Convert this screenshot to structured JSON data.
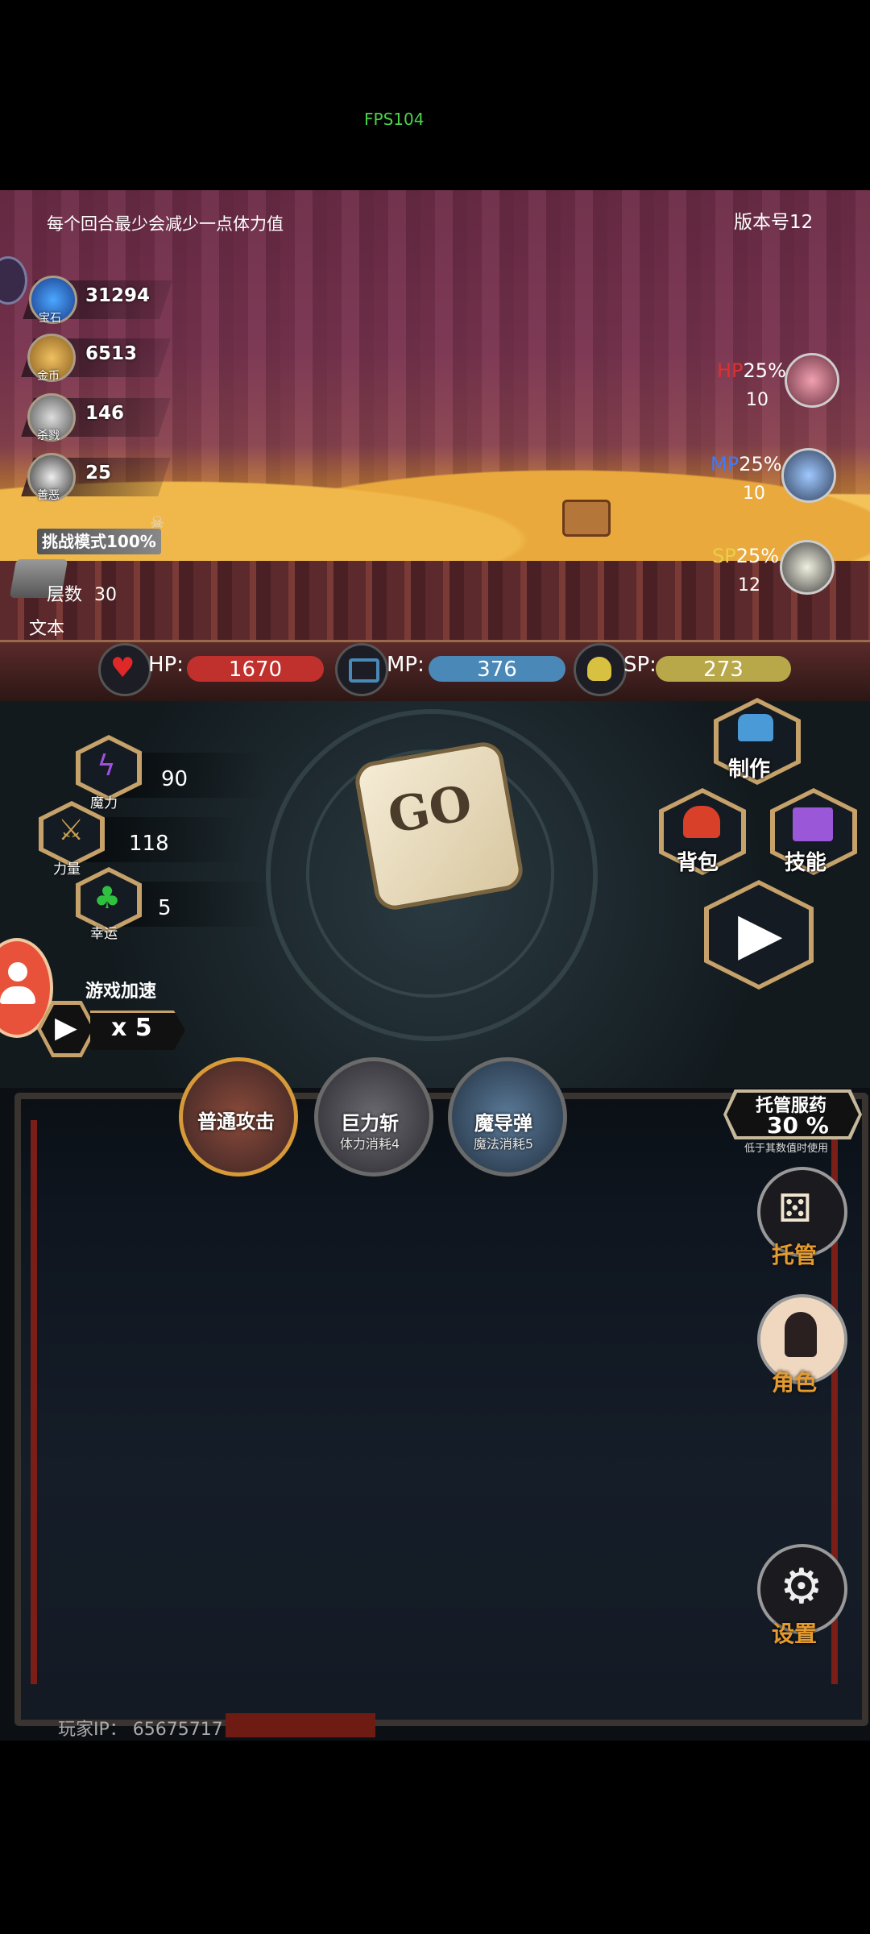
{
  "fps": "FPS104",
  "tip": "每个回合最少会减少一点体力值",
  "version": "版本号12",
  "resources": [
    {
      "icon": "gem-icon",
      "label": "宝石",
      "value": "31294"
    },
    {
      "icon": "gold-coin-icon",
      "label": "金币",
      "value": "6513"
    },
    {
      "icon": "skull-icon",
      "label": "杀戮",
      "value": "146"
    },
    {
      "icon": "mask-icon",
      "label": "善恶",
      "value": "25"
    }
  ],
  "challenge": "挑战模式100%",
  "floor": {
    "label": "层数",
    "value": "30"
  },
  "text_label": "文本",
  "right_stats": [
    {
      "name": "HP",
      "pct": "25%",
      "count": "10",
      "color": "#e03030"
    },
    {
      "name": "MP",
      "pct": "25%",
      "count": "10",
      "color": "#3a7bff"
    },
    {
      "name": "SP",
      "pct": "25%",
      "count": "12",
      "color": "#e8d048"
    }
  ],
  "bars": {
    "hp": {
      "label": "HP:",
      "value": "1670",
      "color": "#c0302c"
    },
    "mp": {
      "label": "MP:",
      "value": "376",
      "color": "#4a88b8"
    },
    "sp": {
      "label": "SP:",
      "value": "273",
      "color": "#b8a84a"
    }
  },
  "attributes": [
    {
      "name": "魔力",
      "value": "90"
    },
    {
      "name": "力量",
      "value": "118"
    },
    {
      "name": "幸运",
      "value": "5"
    }
  ],
  "dice": "GO",
  "speed": {
    "label": "游戏加速",
    "value": "x 5"
  },
  "hex_buttons": {
    "craft": "制作",
    "bag": "背包",
    "skills": "技能"
  },
  "skill_row": [
    {
      "name": "普通攻击",
      "sub": ""
    },
    {
      "name": "巨力斩",
      "sub": "体力消耗4"
    },
    {
      "name": "魔导弹",
      "sub": "魔法消耗5"
    }
  ],
  "auto_potion": {
    "title": "托管服药",
    "pct": "30 %",
    "note": "低于其数值时使用"
  },
  "side_buttons": {
    "auto": "托管",
    "role": "角色",
    "settings": "设置"
  },
  "player_ip": "玩家IP：  65675717"
}
